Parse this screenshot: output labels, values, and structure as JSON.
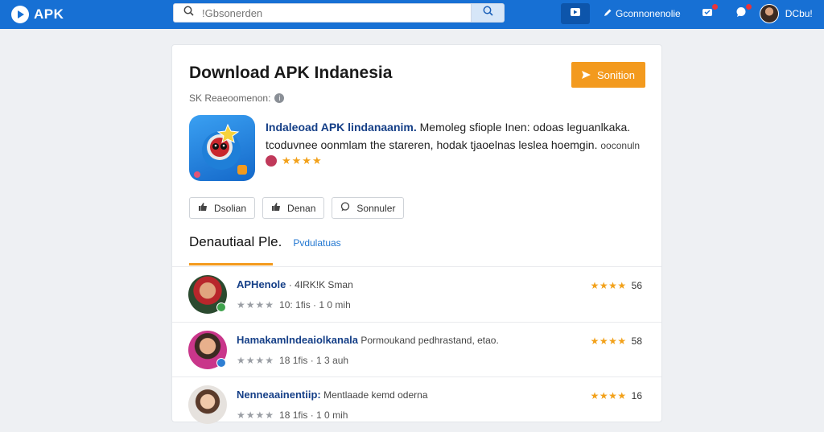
{
  "header": {
    "logo_text": "APK",
    "search_placeholder": "!Gbsonerden",
    "link_label": "Gconnonenolie",
    "user_name": "DCbu!"
  },
  "app": {
    "title": "Download APK Indanesia",
    "subscribe_label": "Sonition",
    "meta_text": "SK Reaeoomenon:",
    "desc_name": "Indaleoad APK lindanaanim.",
    "desc_text": "Memoleg sfiople Inen: odoas leguanlkaka. tcoduvnee oonmlam  the stareren, hodak tjaoelnas leslea hoemgin.",
    "desc_dots": "ooconuln",
    "rating_stars": "★★★★",
    "actions": [
      {
        "label": "Dsolian",
        "icon": "thumbs-up-icon"
      },
      {
        "label": "Denan",
        "icon": "thumbs-up-icon"
      },
      {
        "label": "Sonnuler",
        "icon": "comment-icon"
      }
    ]
  },
  "tabs": {
    "active": "Denautiaal Ple.",
    "other": "Pvdulatuas"
  },
  "reviews": [
    {
      "name": "APHenole",
      "extra": " · 4IRK!K Sman",
      "stars_gray": "★★★★",
      "meta": "10: 1fis  · 1 0 mih",
      "stars": "★★★★",
      "score": "56",
      "avatar_color": "#b8262b",
      "mini_color": "#3fa34d"
    },
    {
      "name": "Hamakamlndeaiolkanala",
      "extra": " Pormoukand pedhrastand, etao.",
      "stars_gray": "★★★★",
      "meta": "18 1fis  · 1 3 auh",
      "stars": "★★★★",
      "score": "58",
      "avatar_color": "#c9368a",
      "mini_color": "#2f7fd3"
    },
    {
      "name": "Nenneaainentiip:",
      "extra": " Mentlaade kemd oderna",
      "stars_gray": "★★★★",
      "meta": "18 1fis  · 1 0 mih",
      "stars": "★★★★",
      "score": "16",
      "avatar_color": "#d8d3cf",
      "mini_color": "#888888"
    }
  ]
}
